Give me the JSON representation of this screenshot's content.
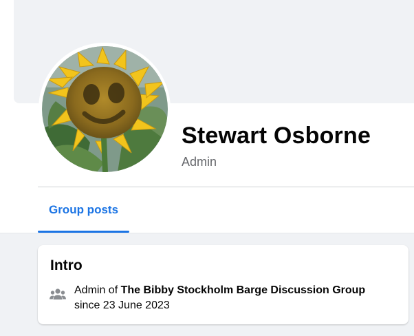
{
  "profile": {
    "name": "Stewart Osborne",
    "role": "Admin"
  },
  "tabs": [
    {
      "label": "Group posts",
      "active": true
    }
  ],
  "intro": {
    "title": "Intro",
    "prefix": "Admin of ",
    "group_name": "The Bibby Stockholm Barge Discussion Group",
    "since": "since 23 June 2023",
    "icon": "group-icon"
  },
  "colors": {
    "accent": "#1b74e4",
    "background": "#f0f2f5",
    "secondary_text": "#65676b"
  }
}
